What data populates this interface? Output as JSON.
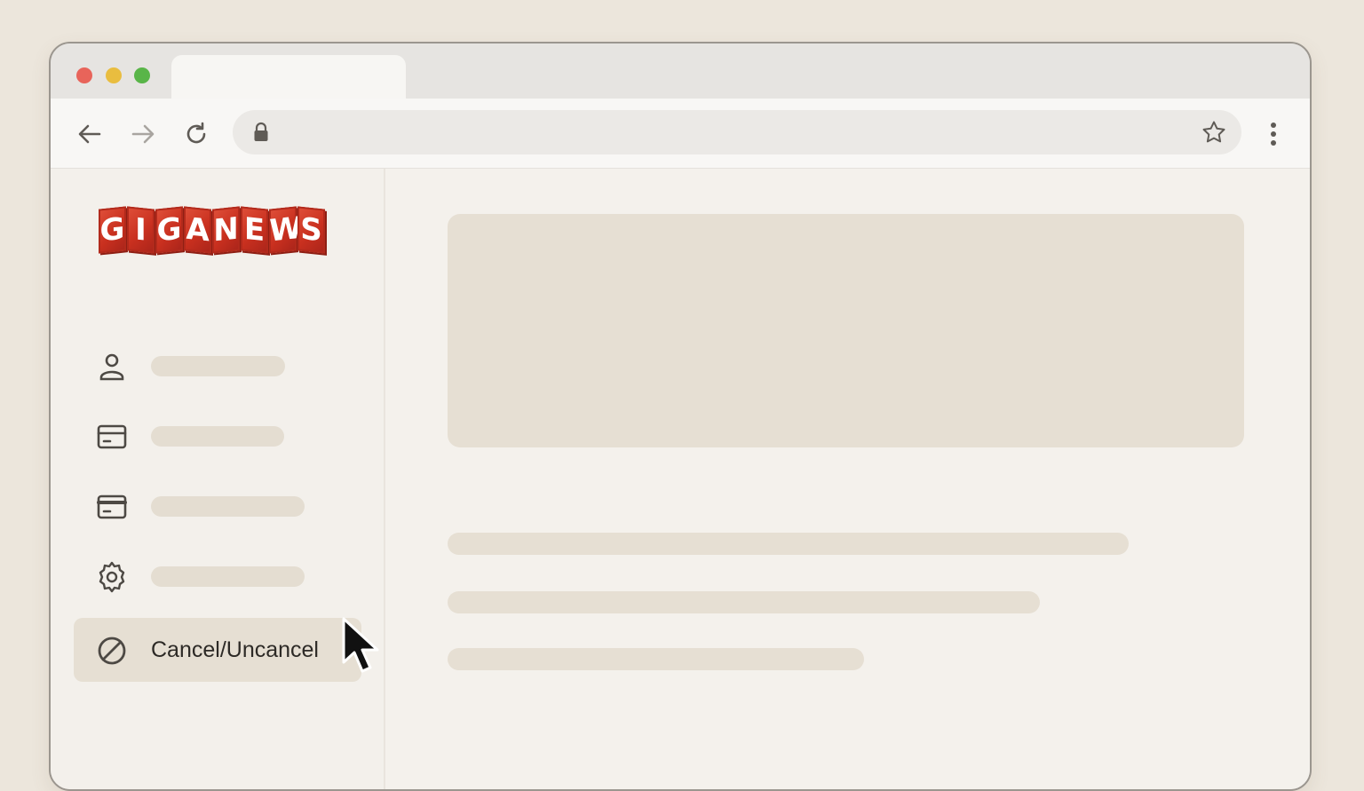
{
  "browser": {
    "traffic_lights": [
      "close",
      "minimize",
      "maximize"
    ],
    "toolbar": {
      "back_icon": "arrow-left-icon",
      "forward_icon": "arrow-right-icon",
      "reload_icon": "reload-icon",
      "lock_icon": "lock-icon",
      "bookmark_icon": "star-icon",
      "menu_icon": "kebab-menu-icon"
    }
  },
  "sidebar": {
    "logo_text": "GIGANEWS",
    "logo_letters": [
      "G",
      "I",
      "G",
      "A",
      "N",
      "E",
      "W",
      "S"
    ],
    "items": [
      {
        "icon": "user-icon",
        "label": ""
      },
      {
        "icon": "billing-card-icon",
        "label": ""
      },
      {
        "icon": "credit-card-icon",
        "label": ""
      },
      {
        "icon": "gear-icon",
        "label": ""
      },
      {
        "icon": "cancel-icon",
        "label": "Cancel/Uncancel",
        "active": true
      }
    ]
  },
  "colors": {
    "background": "#ece6dc",
    "skeleton": "#e6dfd3",
    "logo_red": "#d23b26",
    "active_item": "#e6dfd3",
    "text": "#2d2a26"
  }
}
